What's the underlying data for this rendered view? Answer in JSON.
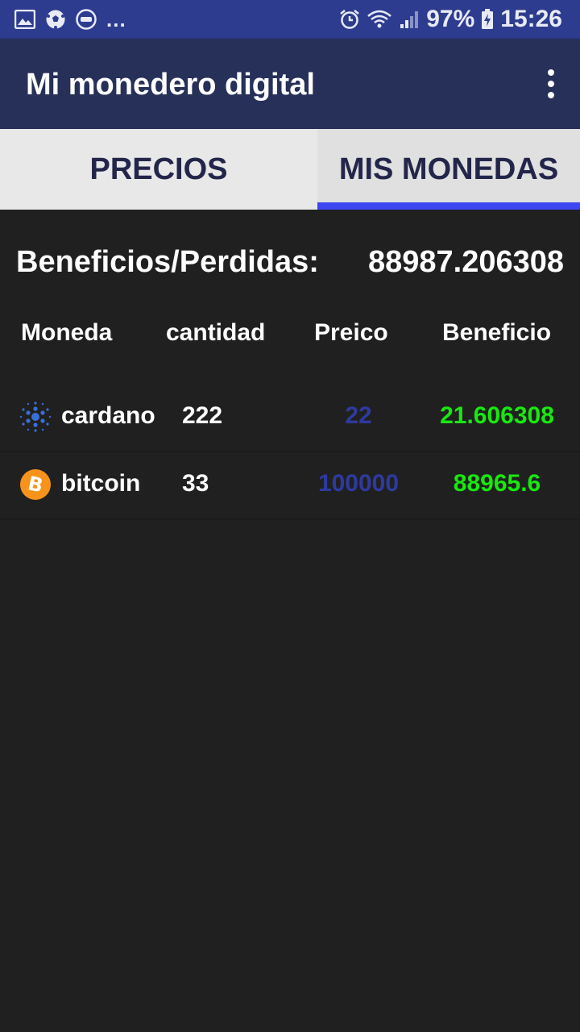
{
  "status_bar": {
    "battery": "97%",
    "time": "15:26",
    "more": "...",
    "icons": [
      "image-icon",
      "soccer-ball-icon",
      "burger-king-icon",
      "alarm-icon",
      "wifi-icon",
      "signal-icon",
      "battery-charging-icon"
    ]
  },
  "app_bar": {
    "title": "Mi monedero digital",
    "overflow_icon": "more-vert-icon"
  },
  "tabs": [
    {
      "label": "PRECIOS",
      "selected": false
    },
    {
      "label": "MIS MONEDAS",
      "selected": true
    }
  ],
  "summary": {
    "label": "Beneficios/Perdidas:",
    "value": "88987.206308"
  },
  "table": {
    "headers": {
      "moneda": "Moneda",
      "cantidad": "cantidad",
      "precio": "Preico",
      "beneficio": "Beneficio"
    },
    "rows": [
      {
        "icon": "cardano-icon",
        "name": "cardano",
        "cantidad": "222",
        "precio": "22",
        "beneficio": "21.606308"
      },
      {
        "icon": "bitcoin-icon",
        "name": "bitcoin",
        "cantidad": "33",
        "precio": "100000",
        "beneficio": "88965.6"
      }
    ]
  },
  "colors": {
    "status_bar": "#2d3c8f",
    "app_bar": "#273058",
    "background": "#202020",
    "tab_indicator": "#3d46f0",
    "price_text": "#2e3a9f",
    "profit_text": "#19e80f"
  }
}
